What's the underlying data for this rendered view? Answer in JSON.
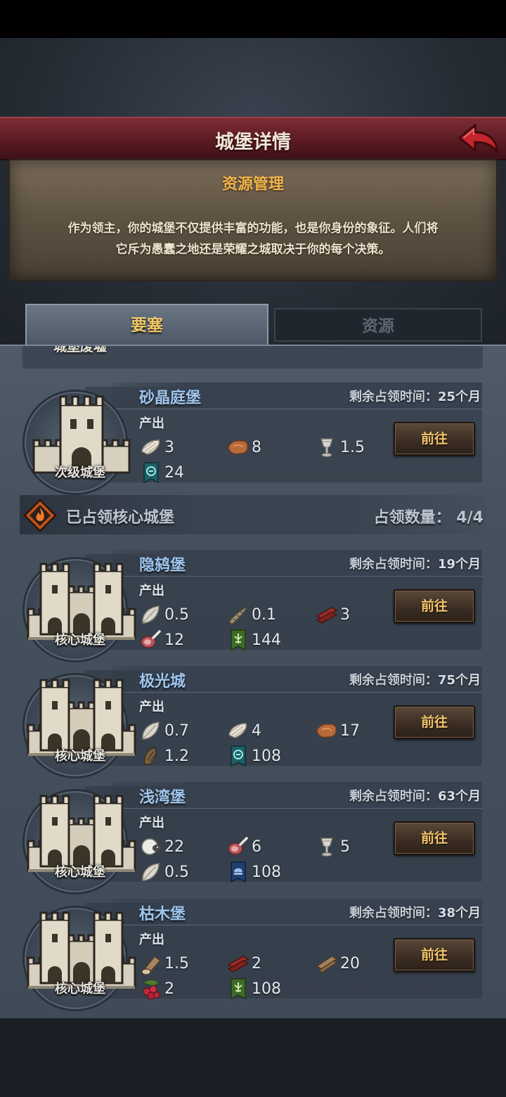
{
  "header": {
    "title": "城堡详情"
  },
  "info": {
    "title": "资源管理",
    "desc_line1": "作为领主，你的城堡不仅提供丰富的功能，也是你身份的象征。人们将",
    "desc_line2": "它斥为愚蠢之地还是荣耀之城取决于你的每个决策。"
  },
  "tabs": {
    "active": "要塞",
    "inactive": "资源"
  },
  "partial_card": {
    "type_label": "城堡废墟"
  },
  "secondary": {
    "name": "砂晶庭堡",
    "type_label": "次级城堡",
    "timer_label": "剩余占领时间：",
    "timer_value": "25",
    "timer_unit": "个月",
    "prod_label": "产出",
    "resources": [
      {
        "icon": "fiber-icon",
        "value": "3"
      },
      {
        "icon": "leather-icon",
        "value": "8"
      },
      {
        "icon": "chalice-icon",
        "value": "1.5"
      },
      {
        "icon": "teal-banner-icon",
        "value": "24"
      }
    ],
    "go_label": "前往"
  },
  "section": {
    "title": "已占领核心城堡",
    "count_label": "占领数量：",
    "count_value": "4/4"
  },
  "core_castles": [
    {
      "name": "隐鸫堡",
      "type_label": "核心城堡",
      "timer_label": "剩余占领时间：",
      "timer_value": "19",
      "timer_unit": "个月",
      "prod_label": "产出",
      "resources": [
        {
          "icon": "feather-icon",
          "value": "0.5"
        },
        {
          "icon": "horn-icon",
          "value": "0.1"
        },
        {
          "icon": "red-planks-icon",
          "value": "3"
        },
        {
          "icon": "meat-icon",
          "value": "12"
        },
        {
          "icon": "green-banner-icon",
          "value": "144"
        }
      ],
      "go_label": "前往"
    },
    {
      "name": "极光城",
      "type_label": "核心城堡",
      "timer_label": "剩余占领时间：",
      "timer_value": "75",
      "timer_unit": "个月",
      "prod_label": "产出",
      "resources": [
        {
          "icon": "feather-icon",
          "value": "0.7"
        },
        {
          "icon": "fiber-icon",
          "value": "4"
        },
        {
          "icon": "leather-icon",
          "value": "17"
        },
        {
          "icon": "claw-icon",
          "value": "1.2"
        },
        {
          "icon": "teal-banner-icon",
          "value": "108"
        }
      ],
      "go_label": "前往"
    },
    {
      "name": "浅湾堡",
      "type_label": "核心城堡",
      "timer_label": "剩余占领时间：",
      "timer_value": "63",
      "timer_unit": "个月",
      "prod_label": "产出",
      "resources": [
        {
          "icon": "sheep-icon",
          "value": "22"
        },
        {
          "icon": "meat-icon",
          "value": "6"
        },
        {
          "icon": "chalice-icon",
          "value": "5"
        },
        {
          "icon": "feather-icon",
          "value": "0.5"
        },
        {
          "icon": "blue-banner-icon",
          "value": "108"
        }
      ],
      "go_label": "前往"
    },
    {
      "name": "枯木堡",
      "type_label": "核心城堡",
      "timer_label": "剩余占领时间：",
      "timer_value": "38",
      "timer_unit": "个月",
      "prod_label": "产出",
      "resources": [
        {
          "icon": "log-icon",
          "value": "1.5"
        },
        {
          "icon": "red-planks-icon",
          "value": "2"
        },
        {
          "icon": "wood-planks-icon",
          "value": "20"
        },
        {
          "icon": "berries-icon",
          "value": "2"
        },
        {
          "icon": "green-banner-icon",
          "value": "108"
        }
      ],
      "go_label": "前往"
    }
  ],
  "colors": {
    "header_red": "#6a222a",
    "accent_gold": "#f3c46a",
    "name_blue": "#9ec6ef",
    "parchment": "#5f5343"
  }
}
